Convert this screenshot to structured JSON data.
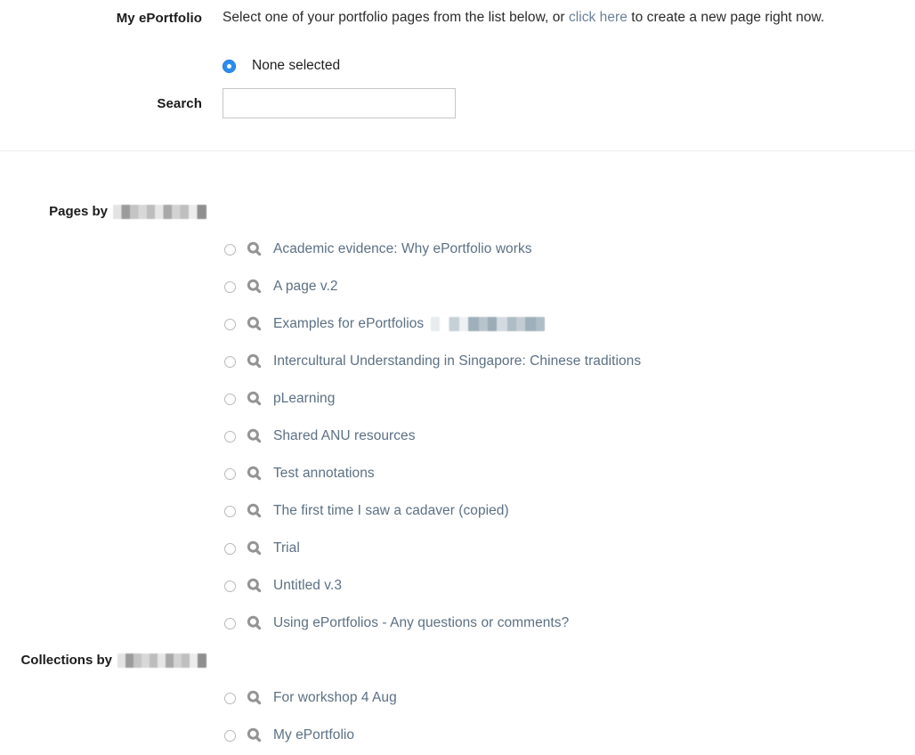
{
  "form": {
    "my_eportfolio_label": "My ePortfolio",
    "intro_before_link": "Select one of your portfolio pages from the list below, or ",
    "intro_link": "click here",
    "intro_after_link": " to create a new page right now.",
    "none_selected_label": "None selected",
    "search_label": "Search",
    "search_value": "",
    "search_placeholder": ""
  },
  "sections": [
    {
      "heading_prefix": "Pages by",
      "heading_redacted_name": "",
      "items": [
        {
          "label": "Academic evidence: Why ePortfolio works",
          "redacted_suffix": false
        },
        {
          "label": "A page v.2",
          "redacted_suffix": false
        },
        {
          "label": "Examples for ePortfolios",
          "redacted_suffix": true
        },
        {
          "label": "Intercultural Understanding in Singapore: Chinese traditions",
          "redacted_suffix": false
        },
        {
          "label": "pLearning",
          "redacted_suffix": false
        },
        {
          "label": "Shared ANU resources",
          "redacted_suffix": false
        },
        {
          "label": "Test annotations",
          "redacted_suffix": false
        },
        {
          "label": "The first time I saw a cadaver (copied)",
          "redacted_suffix": false
        },
        {
          "label": "Trial",
          "redacted_suffix": false
        },
        {
          "label": "Untitled v.3",
          "redacted_suffix": false
        },
        {
          "label": "Using ePortfolios - Any questions or comments?",
          "redacted_suffix": false
        }
      ]
    },
    {
      "heading_prefix": "Collections by",
      "heading_redacted_name": "",
      "items": [
        {
          "label": "For workshop 4 Aug",
          "redacted_suffix": false
        },
        {
          "label": "My ePortfolio",
          "redacted_suffix": false
        }
      ]
    }
  ],
  "icons": {
    "magnifier": "search-icon",
    "radio_selected": "radio-selected-icon",
    "radio_unselected": "radio-unselected-icon"
  },
  "colors": {
    "link": "#6a7f95",
    "option_text": "#5c7083",
    "radio_accent": "#2b8cf0",
    "icon_gray": "#949494",
    "divider": "#ededef",
    "input_border": "#c6c6c6",
    "page_background": "#ffffff"
  }
}
